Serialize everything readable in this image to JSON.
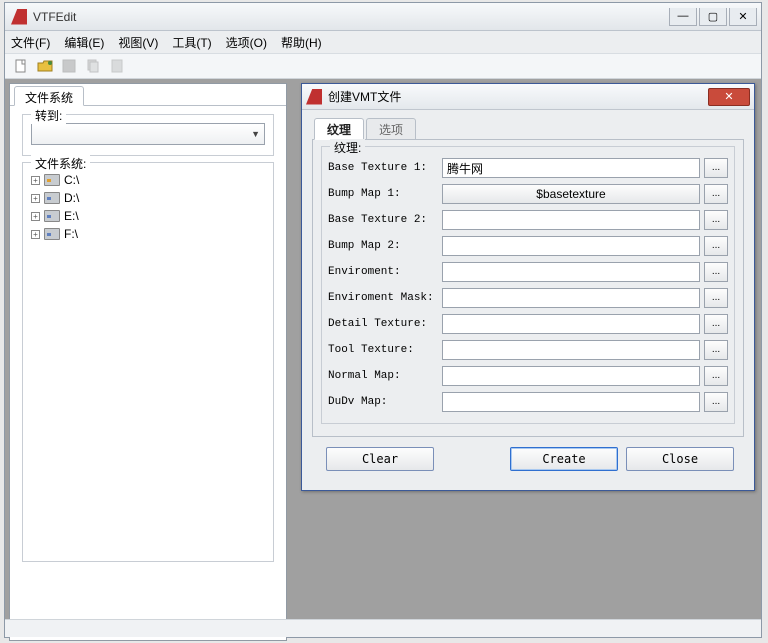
{
  "window": {
    "title": "VTFEdit",
    "menus": [
      "文件(F)",
      "编辑(E)",
      "视图(V)",
      "工具(T)",
      "选项(O)",
      "帮助(H)"
    ]
  },
  "panel": {
    "tab": "文件系统",
    "goto_label": "转到:",
    "tree_label": "文件系统:",
    "drives": [
      "C:\\",
      "D:\\",
      "E:\\",
      "F:\\"
    ]
  },
  "dialog": {
    "title": "创建VMT文件",
    "tabs": [
      "纹理",
      "选项"
    ],
    "group_label": "纹理:",
    "fields": [
      {
        "label": "Base Texture 1:",
        "value": "腾牛网",
        "type": "text"
      },
      {
        "label": "Bump Map 1:",
        "value": "$basetexture",
        "type": "button"
      },
      {
        "label": "Base Texture 2:",
        "value": "",
        "type": "text"
      },
      {
        "label": "Bump Map 2:",
        "value": "",
        "type": "text"
      },
      {
        "label": "Enviroment:",
        "value": "",
        "type": "text"
      },
      {
        "label": "Enviroment Mask:",
        "value": "",
        "type": "text"
      },
      {
        "label": "Detail Texture:",
        "value": "",
        "type": "text"
      },
      {
        "label": "Tool Texture:",
        "value": "",
        "type": "text"
      },
      {
        "label": "Normal Map:",
        "value": "",
        "type": "text"
      },
      {
        "label": "DuDv Map:",
        "value": "",
        "type": "text"
      }
    ],
    "browse_label": "...",
    "actions": {
      "clear": "Clear",
      "create": "Create",
      "close": "Close"
    }
  },
  "winctrl": {
    "min": "—",
    "max": "▢",
    "close": "✕"
  }
}
